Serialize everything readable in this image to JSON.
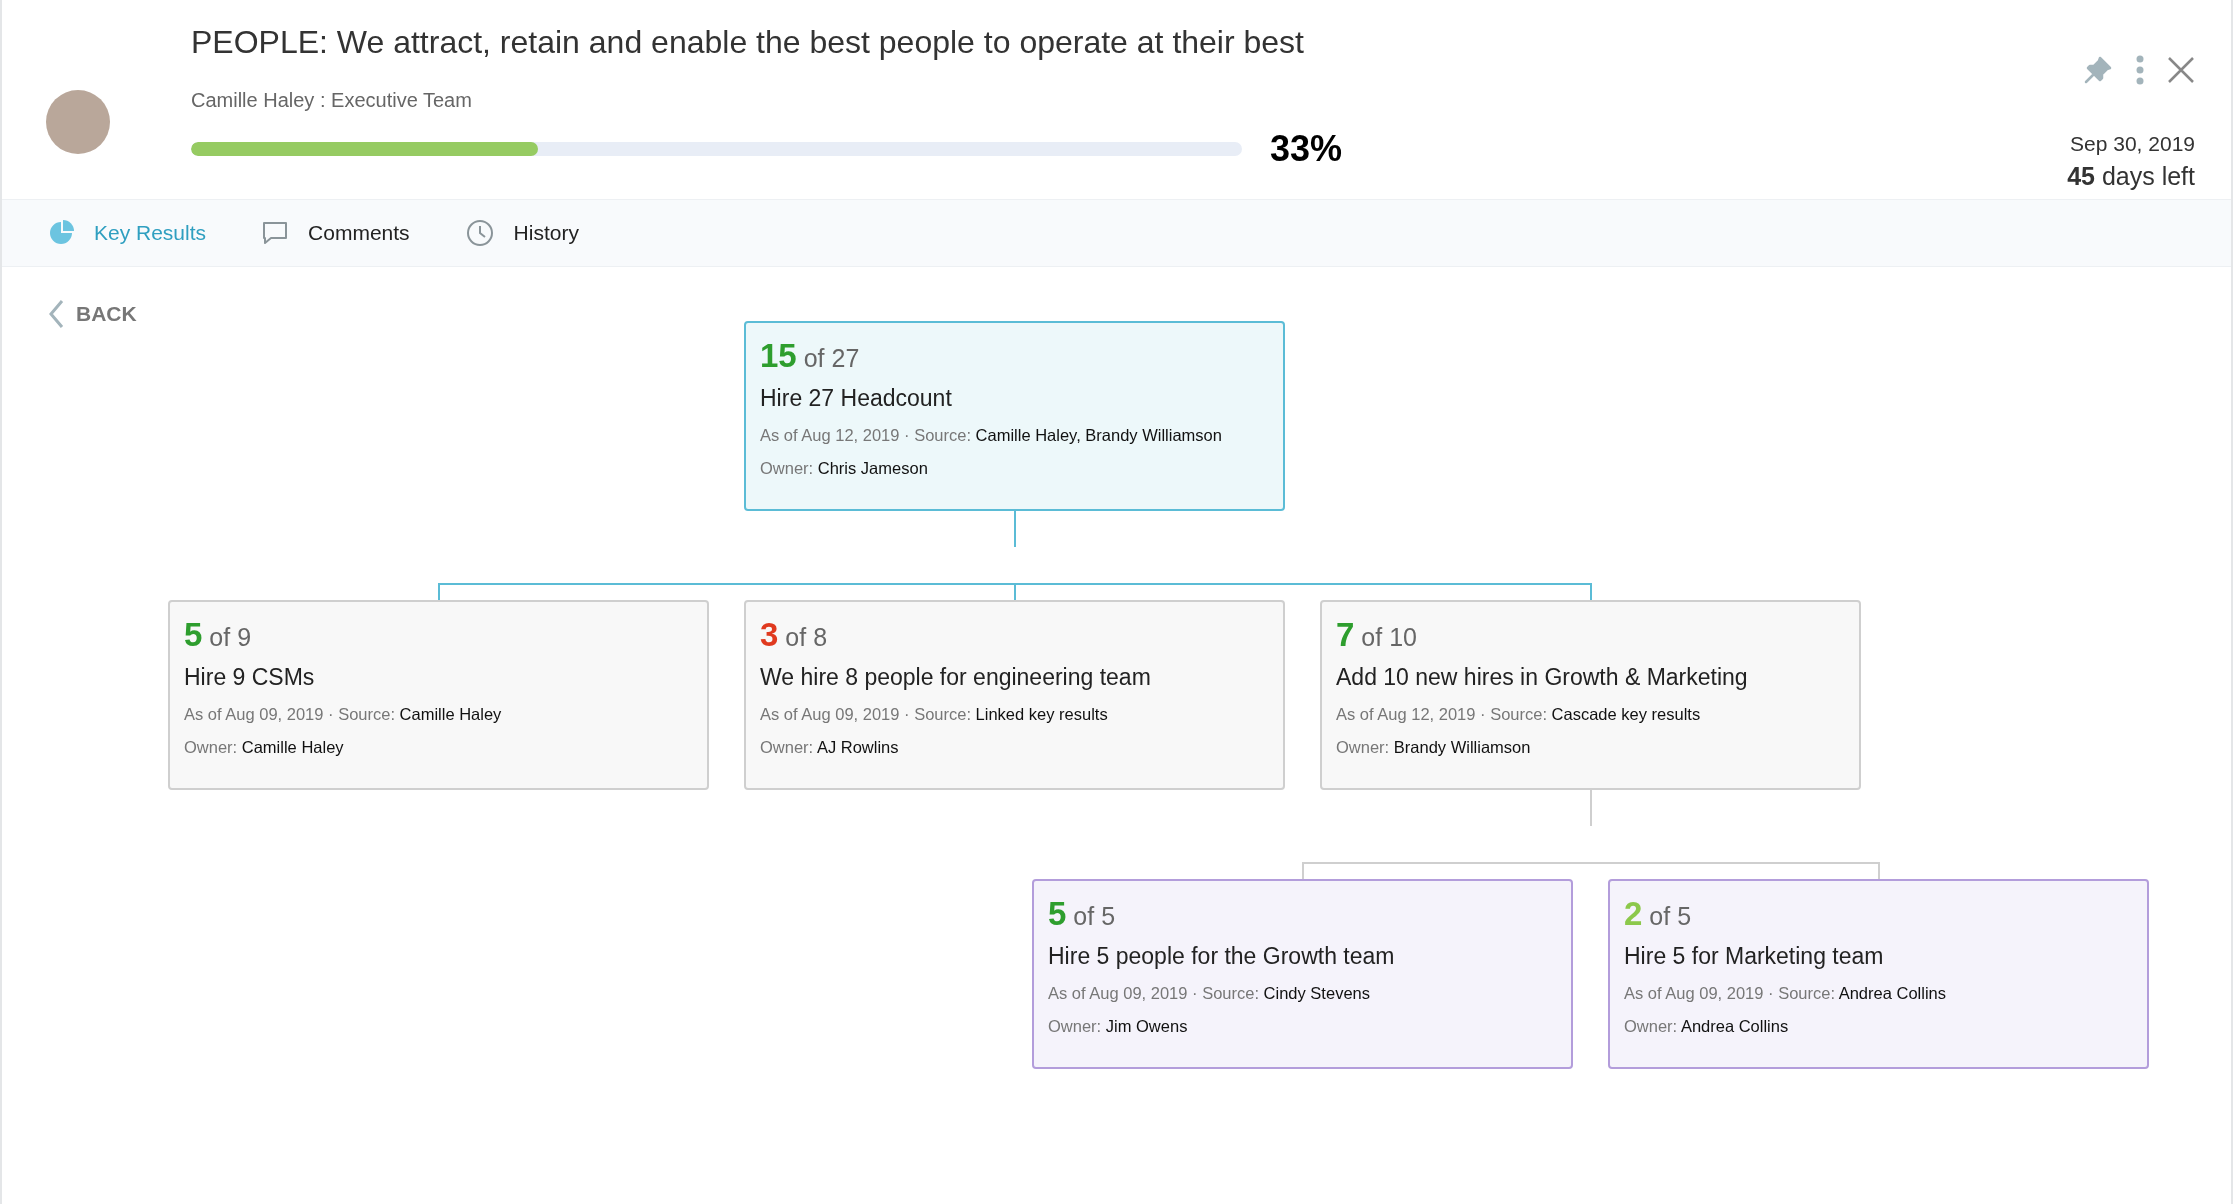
{
  "header": {
    "title": "PEOPLE: We attract, retain and enable the best people to operate at their best",
    "subtitle": "Camille Haley : Executive Team",
    "progress": {
      "level": 0.33,
      "reading": "33%"
    },
    "due_date": "Sep 30, 2019",
    "days_left": "**45** days left"
  },
  "tabs": [
    {
      "label": "Key Results",
      "selected": true
    },
    {
      "label": "Comments",
      "selected": false
    },
    {
      "label": "History",
      "selected": false
    }
  ],
  "back": "BACK",
  "tree": {
    "kind": "highlighted",
    "score": "15",
    "color": "#2e9e2e",
    "target": "of 27",
    "title": "Hire 27 Headcount",
    "as_of": "As of Aug 12, 2019 ·",
    "source_label": "Source:",
    "source": "Camille Haley, Brandy Williamson",
    "owner_label": "Owner:",
    "owner": "Chris Jameson",
    "children": [
      {
        "kind": "plain",
        "score": "5",
        "color": "#2e9e2e",
        "target": "of 9",
        "title": "Hire 9 CSMs",
        "as_of": "As of Aug 09, 2019 ·",
        "source_label": "Source:",
        "source": "Camille Haley",
        "owner_label": "Owner:",
        "owner": "Camille Haley"
      },
      {
        "kind": "plain",
        "score": "3",
        "color": "#e03a1f",
        "target": "of 8",
        "title": "We hire 8 people for engineering team",
        "as_of": "As of Aug 09, 2019 ·",
        "source_label": "Source:",
        "source": "Linked key results",
        "owner_label": "Owner:",
        "owner": "AJ Rowlins"
      },
      {
        "kind": "plain",
        "score": "7",
        "color": "#2e9e2e",
        "target": "of 10",
        "title": "Add 10 new hires in Growth & Marketing",
        "as_of": "As of Aug 12, 2019 ·",
        "source_label": "Source:",
        "source": "Cascade key results",
        "owner_label": "Owner:",
        "owner": "Brandy Williamson",
        "children": [
          {
            "kind": "linked",
            "score": "5",
            "color": "#2e9e2e",
            "target": "of 5",
            "title": "Hire 5 people for the Growth team",
            "as_of": "As of Aug 09, 2019 ·",
            "source_label": "Source:",
            "source": "Cindy Stevens",
            "owner_label": "Owner:",
            "owner": "Jim Owens"
          },
          {
            "kind": "linked",
            "score": "2",
            "color": "#8cc84b",
            "target": "of 5",
            "title": "Hire 5 for Marketing team",
            "as_of": "As of Aug 09, 2019 ·",
            "source_label": "Source:",
            "source": "Andrea Collins",
            "owner_label": "Owner:",
            "owner": "Andrea Collins"
          }
        ]
      }
    ]
  }
}
